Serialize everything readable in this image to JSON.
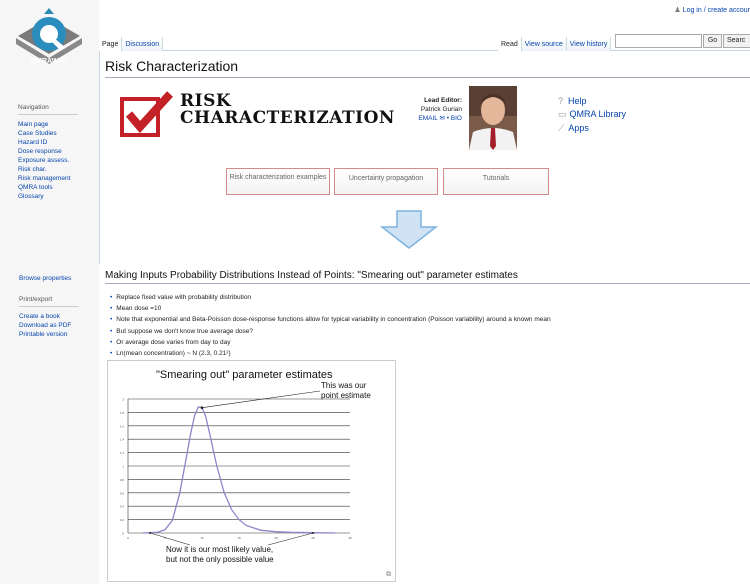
{
  "user_links": "Log in / create accour",
  "tabs_left": [
    "Page",
    "Discussion"
  ],
  "tabs_right": [
    "Read",
    "View source",
    "View history"
  ],
  "search": {
    "go": "Go",
    "search": "Searc"
  },
  "logo": {
    "text": "QMRAWIKI"
  },
  "sidebar": {
    "nav_heading": "Navigation",
    "items": [
      "Main page",
      "Case Studies",
      "Hazard ID",
      "Dose response",
      "Exposure assess.",
      "Risk char.",
      "Risk management",
      "QMRA tools",
      "Glossary"
    ],
    "browse": "Browse properties",
    "print_heading": "Print/export",
    "print_items": [
      "Create a book",
      "Download as PDF",
      "Printable version"
    ]
  },
  "page_title": "Risk Characterization",
  "banner": {
    "line1": "RISK",
    "line2": "CHARACTERIZATION"
  },
  "editor": {
    "label": "Lead Editor:",
    "name": "Patrick Gurian",
    "links": "EMAIL ✉ • BIO"
  },
  "resources": [
    "Help",
    "QMRA Library",
    "Apps"
  ],
  "buttons": [
    "Risk characterization examples",
    "Uncertainty propagation",
    "Tutorials"
  ],
  "content_title": "Making Inputs Probability Distributions Instead of Points: \"Smearing out\" parameter estimates",
  "bullets": [
    "Replace fixed value with probability distribution",
    "Mean dose =10",
    "Note that exponential and Beta-Poisson dose-response functions allow for typical variability in concentration (Poisson variability) around a known mean",
    "But suppose we don't know true average dose?",
    "Or average dose varies from day to day",
    "Ln(mean concentration) ~ N (2.3, 0.21²)"
  ],
  "figure": {
    "title": "\"Smearing out\" parameter estimates",
    "callout_top": [
      "This was our",
      "point estimate"
    ],
    "callout_bottom": [
      "Now it is our most likely value,",
      "but not the only possible value"
    ]
  },
  "chart_data": {
    "type": "line",
    "title": "\"Smearing out\" parameter estimates",
    "xlabel": "",
    "ylabel": "",
    "xlim": [
      0,
      30
    ],
    "ylim": [
      0,
      2
    ],
    "yticks": [
      0,
      0.2,
      0.4,
      0.6,
      0.8,
      1,
      1.2,
      1.4,
      1.6,
      1.8,
      2
    ],
    "xticks": [
      0,
      5,
      10,
      15,
      20,
      25,
      30
    ],
    "series": [
      {
        "x": [
          2,
          4,
          5,
          6,
          7,
          8,
          8.5,
          9,
          9.5,
          10,
          10.5,
          11,
          12,
          13,
          14,
          15,
          16,
          18,
          20,
          22,
          25,
          28
        ],
        "y": [
          0,
          0.01,
          0.05,
          0.19,
          0.6,
          1.2,
          1.5,
          1.75,
          1.88,
          1.87,
          1.74,
          1.5,
          1.0,
          0.6,
          0.35,
          0.2,
          0.11,
          0.04,
          0.02,
          0.01,
          0.005,
          0
        ]
      }
    ],
    "point_estimate": [
      10,
      1.87
    ]
  },
  "colors": {
    "link": "#0645ad",
    "curve": "#8b86c9",
    "check": "#c32027",
    "arrow": "#7fb2df"
  }
}
